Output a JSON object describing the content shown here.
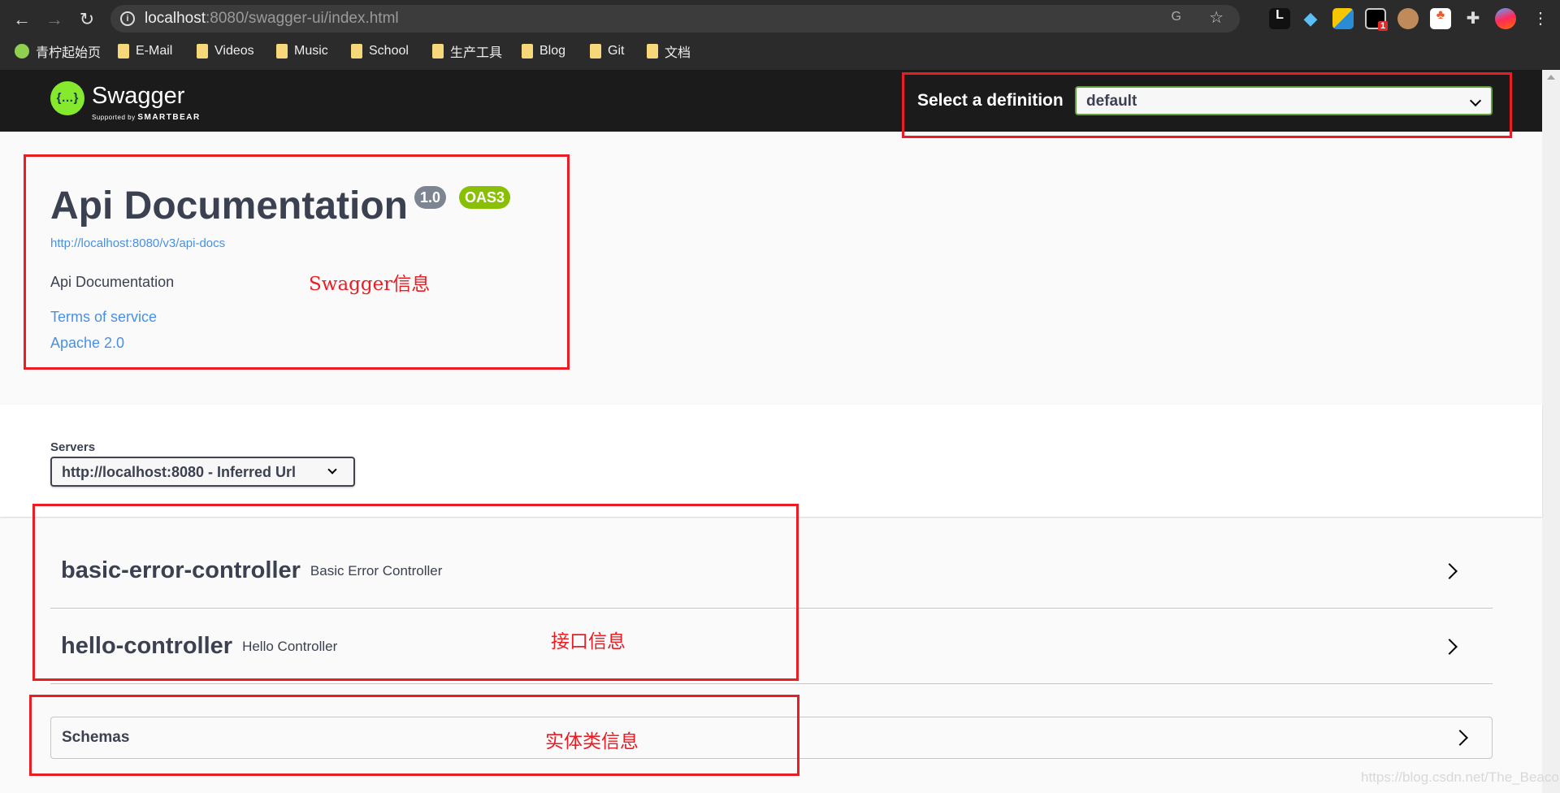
{
  "browser": {
    "url_host": "localhost",
    "url_rest": ":8080/swagger-ui/index.html",
    "bookmarks": [
      "青柠起始页",
      "E-Mail",
      "Videos",
      "Music",
      "School",
      "生产工具",
      "Blog",
      "Git",
      "文档"
    ],
    "extension_badge": "1"
  },
  "header": {
    "logo_text": "Swagger",
    "logo_sub": "Supported by",
    "logo_brand": "SMARTBEAR",
    "logo_glyph": "{…}",
    "definition_label": "Select a definition",
    "definition_value": "default"
  },
  "info": {
    "title": "Api Documentation",
    "version": "1.0",
    "oas": "OAS3",
    "url": "http://localhost:8080/v3/api-docs",
    "description": "Api Documentation",
    "terms": "Terms of service",
    "license": "Apache 2.0"
  },
  "servers": {
    "label": "Servers",
    "value": "http://localhost:8080 - Inferred Url"
  },
  "tags": [
    {
      "name": "basic-error-controller",
      "desc": "Basic Error Controller"
    },
    {
      "name": "hello-controller",
      "desc": "Hello Controller"
    }
  ],
  "schemas": {
    "label": "Schemas"
  },
  "annotations": {
    "swagger": "Swagger信息",
    "api": "接口信息",
    "entity": "实体类信息"
  },
  "watermark": "https://blog.csdn.net/The_Beacon",
  "colors": {
    "accent": "#85ea2d",
    "link": "#4990e2",
    "annotation": "#ea1c24",
    "version_badge": "#7d8492",
    "oas_badge": "#89bf04"
  }
}
